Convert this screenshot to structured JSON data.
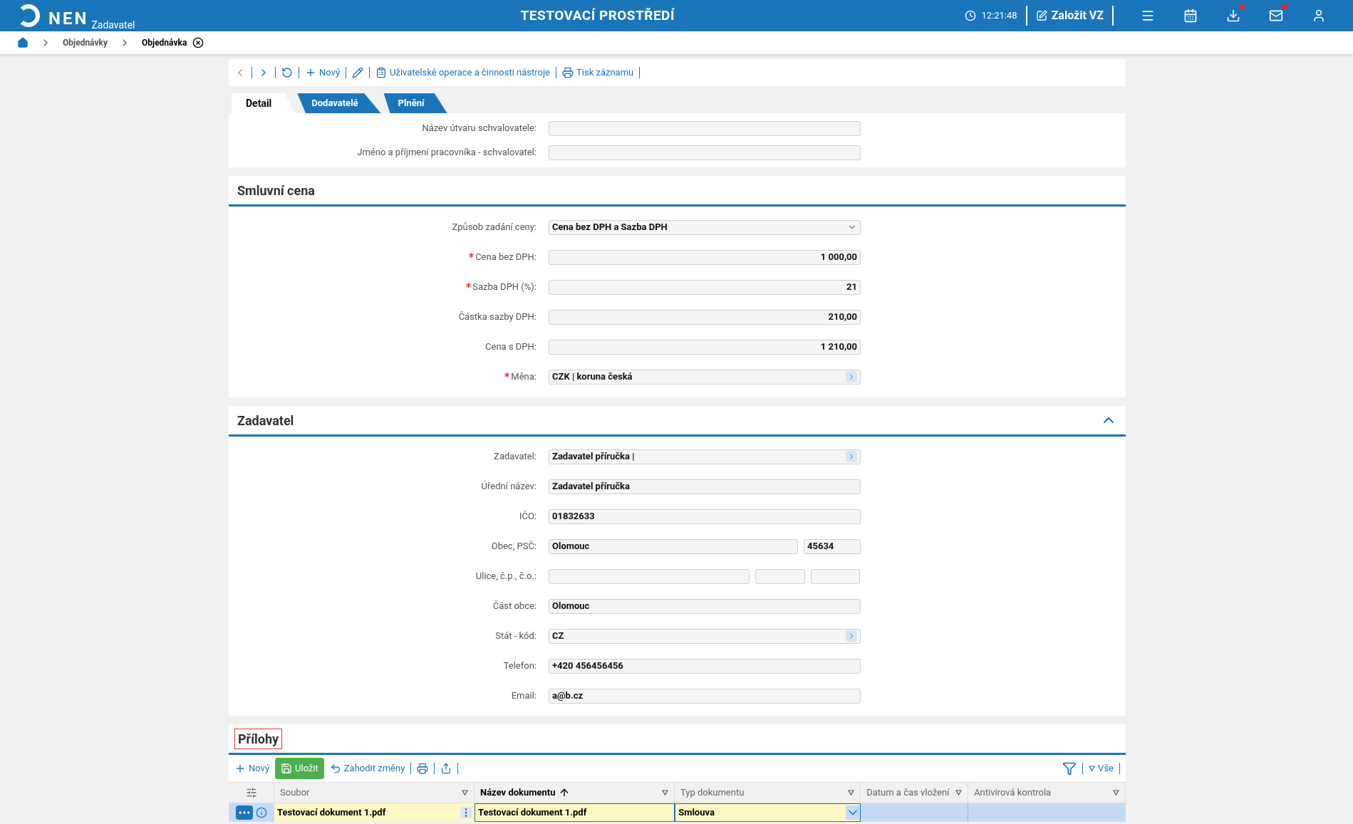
{
  "header": {
    "logo": "NEN",
    "subtitle": "Zadavatel",
    "environment": "TESTOVACÍ PROSTŘEDÍ",
    "time": "12:21:48",
    "create_button": "Založit VZ",
    "icons": [
      {
        "kind": "menu",
        "badge": false
      },
      {
        "kind": "calendar",
        "badge": false
      },
      {
        "kind": "download",
        "badge": true
      },
      {
        "kind": "mail",
        "badge": true
      },
      {
        "kind": "user",
        "badge": false
      }
    ]
  },
  "breadcrumbs": [
    {
      "label": "Objednávky",
      "current": false
    },
    {
      "label": "Objednávka",
      "current": true
    }
  ],
  "toolbar": {
    "new": "Nový",
    "operations": "Uživatelské operace a činnosti nástroje",
    "print": "Tisk záznamu"
  },
  "tabs": [
    {
      "label": "Detail",
      "selected": true
    },
    {
      "label": "Dodavatelé",
      "selected": false
    },
    {
      "label": "Plnění",
      "selected": false
    }
  ],
  "approver_fields": [
    {
      "label": "Název útvaru schvalovatele:"
    },
    {
      "label": "Jméno a příjmení pracovníka - schvalovatel:"
    }
  ],
  "price_section": {
    "title": "Smluvní cena",
    "fields": [
      {
        "kind": "select",
        "label": "Způsob zadání ceny:",
        "required": false,
        "value": "Cena bez DPH a Sazba DPH"
      },
      {
        "kind": "number",
        "label": "Cena bez DPH:",
        "required": true,
        "value": "1 000,00"
      },
      {
        "kind": "number",
        "label": "Sazba DPH (%):",
        "required": true,
        "value": "21"
      },
      {
        "kind": "number",
        "label": "Částka sazby DPH:",
        "required": false,
        "value": "210,00"
      },
      {
        "kind": "number",
        "label": "Cena s DPH:",
        "required": false,
        "value": "1 210,00"
      },
      {
        "kind": "lookup",
        "label": "Měna:",
        "required": true,
        "value": "CZK | koruna česká"
      }
    ]
  },
  "contracting_section": {
    "title": "Zadavatel",
    "expanded": true,
    "fields": [
      {
        "kind": "lookup",
        "label": "Zadavatel:",
        "value": "Zadavatel příručka |"
      },
      {
        "kind": "text",
        "label": "Úřední název:",
        "value": "Zadavatel příručka"
      },
      {
        "kind": "text",
        "label": "IČO:",
        "value": "01832633"
      },
      {
        "kind": "pair",
        "label": "Obec, PSČ:",
        "values": [
          "Olomouc",
          "45634"
        ]
      },
      {
        "kind": "triple",
        "label": "Ulice, č.p., č.o.:"
      },
      {
        "kind": "text",
        "label": "Část obce:",
        "value": "Olomouc"
      },
      {
        "kind": "lookup",
        "label": "Stát - kód:",
        "value": "CZ"
      },
      {
        "kind": "text",
        "label": "Telefon:",
        "value": "+420 456456456"
      },
      {
        "kind": "text",
        "label": "Email:",
        "value": "a@b.cz"
      }
    ]
  },
  "attachments": {
    "title": "Přílohy",
    "new": "Nový",
    "save": "Uložit",
    "discard": "Zahodit změny",
    "filter": "Vše",
    "columns": [
      {
        "label": "Soubor",
        "sorted": false
      },
      {
        "label": "Název dokumentu",
        "sorted": true
      },
      {
        "label": "Typ dokumentu",
        "sorted": false
      },
      {
        "label": "Datum a čas vložení",
        "sorted": false
      },
      {
        "label": "Antivirová kontrola",
        "sorted": false
      }
    ],
    "rows": [
      {
        "selected": true,
        "file": "Testovací dokument 1.pdf",
        "name": "Testovací dokument 1.pdf",
        "type": "Smlouva"
      }
    ]
  }
}
